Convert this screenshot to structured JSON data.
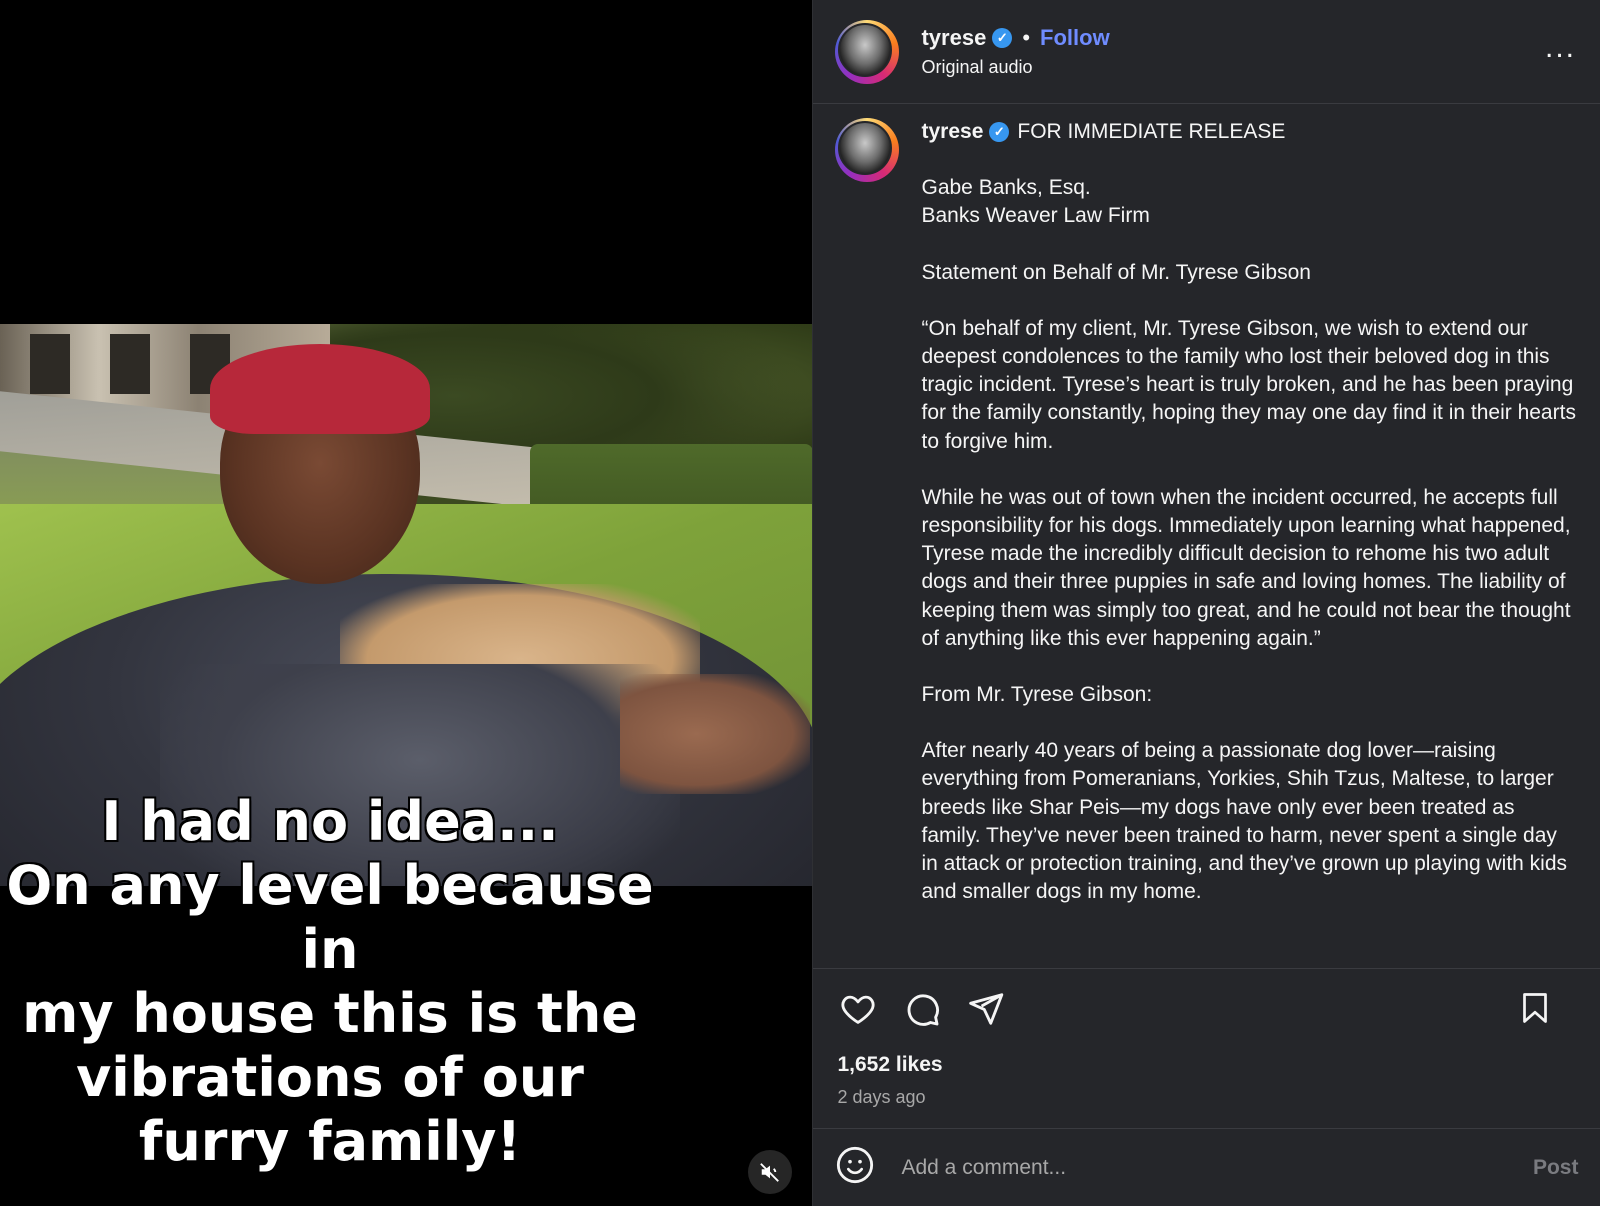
{
  "video": {
    "caption": "I had no idea...\nOn any level because in\nmy house this is the\nvibrations of our\nfurry family!"
  },
  "header": {
    "username": "tyrese",
    "follow_label": "Follow",
    "separator": "•",
    "audio": "Original audio",
    "more": "..."
  },
  "post": {
    "username": "tyrese",
    "headline": "FOR IMMEDIATE RELEASE",
    "paragraphs": [
      "Gabe Banks, Esq.\nBanks Weaver Law Firm",
      "Statement on Behalf of Mr. Tyrese Gibson",
      "“On behalf of my client, Mr. Tyrese Gibson, we wish to extend our deepest condolences to the family who lost their beloved dog in this tragic incident. Tyrese’s heart is truly broken, and he has been praying for the family constantly, hoping they may one day find it in their hearts to forgive him.",
      "While he was out of town when the incident occurred, he accepts full responsibility for his dogs. Immediately upon learning what happened, Tyrese made the incredibly difficult decision to rehome his two adult dogs and their three puppies in safe and loving homes. The liability of keeping them was simply too great, and he could not bear the thought of anything like this ever happening again.”",
      "From Mr. Tyrese Gibson:",
      "After nearly 40 years of being a passionate dog lover—raising everything from Pomeranians, Yorkies, Shih Tzus, Maltese, to larger breeds like Shar Peis—my dogs have only ever been treated as family. They’ve never been trained to harm, never spent a single day in attack or protection training, and they’ve grown up playing with kids and smaller dogs in my home."
    ]
  },
  "stats": {
    "likes": "1,652 likes",
    "time": "2 days ago"
  },
  "comment": {
    "placeholder": "Add a comment...",
    "post_label": "Post"
  },
  "colors": {
    "accent": "#6f8cff",
    "verified": "#3797f0",
    "panel": "#25262a"
  }
}
